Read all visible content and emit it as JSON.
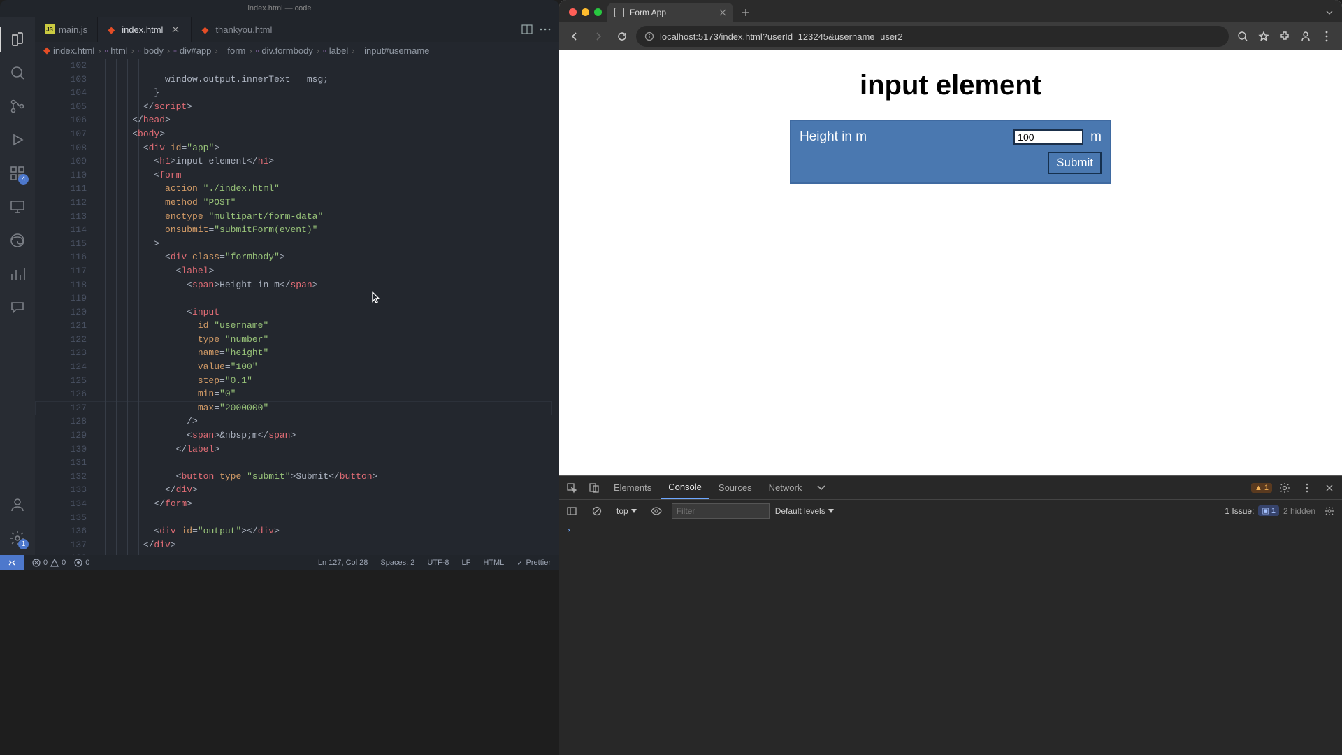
{
  "vscode": {
    "title": "index.html — code",
    "activitybar": {
      "extensions_badge": "4",
      "settings_badge": "1"
    },
    "tabs": [
      {
        "label": "main.js",
        "icon": "js"
      },
      {
        "label": "index.html",
        "icon": "html",
        "active": true
      },
      {
        "label": "thankyou.html",
        "icon": "html"
      }
    ],
    "breadcrumbs": [
      "index.html",
      "html",
      "body",
      "div#app",
      "form",
      "div.formbody",
      "label",
      "input#username"
    ],
    "lines_start": 102,
    "lines_end": 137,
    "statusbar": {
      "errors": "0",
      "warnings": "0",
      "ports": "0",
      "cursor": "Ln 127, Col 28",
      "spaces": "Spaces: 2",
      "encoding": "UTF-8",
      "eol": "LF",
      "mode": "HTML",
      "formatter": "Prettier"
    }
  },
  "chrome": {
    "tab_title": "Form App",
    "url": "localhost:5173/index.html?userId=123245&username=user2",
    "page": {
      "heading": "input element",
      "label": "Height in m",
      "input_value": "100",
      "unit": "m",
      "submit": "Submit"
    },
    "devtools": {
      "tabs": [
        "Elements",
        "Console",
        "Sources",
        "Network"
      ],
      "active_tab": "Console",
      "badge_count": "1",
      "console": {
        "context": "top",
        "filter_placeholder": "Filter",
        "levels": "Default levels",
        "issues_label": "1 Issue:",
        "issues_count": "1",
        "hidden": "2 hidden"
      }
    }
  }
}
